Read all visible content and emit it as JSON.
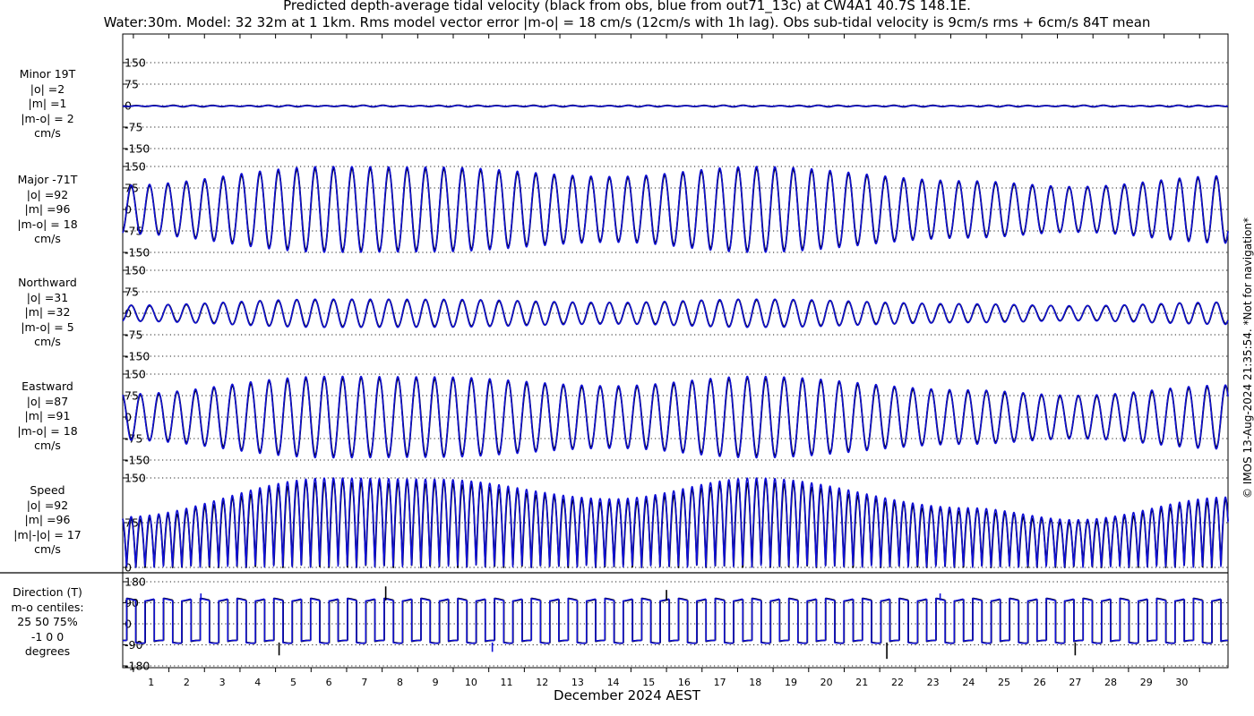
{
  "title_line1": "Predicted depth-average tidal velocity (black from obs, blue from out71_13c) at CW4A1 40.7S 148.1E.",
  "title_line2": "Water:30m. Model: 32 32m at 1 1km. Rms model vector error |m-o| = 18 cm/s (12cm/s with 1h lag). Obs sub-tidal velocity is 9cm/s rms + 6cm/s 84T mean",
  "side_note": "© IMOS 13-Aug-2024 21:35:54. *Not for navigation*",
  "xlabel": "December 2024 AEST",
  "colors": {
    "obs": "#000000",
    "model": "#1010d8",
    "grid": "#222222"
  },
  "panels": [
    {
      "id": "minor",
      "label": [
        "Minor 19T",
        "|o| =2",
        "|m| =1",
        "|m-o| = 2",
        "cm/s"
      ]
    },
    {
      "id": "major",
      "label": [
        "Major -71T",
        "|o| =92",
        "|m| =96",
        "|m-o| = 18",
        "cm/s"
      ]
    },
    {
      "id": "north",
      "label": [
        "Northward",
        "|o| =31",
        "|m| =32",
        "|m-o| = 5",
        "cm/s"
      ]
    },
    {
      "id": "east",
      "label": [
        "Eastward",
        "|o| =87",
        "|m| =91",
        "|m-o| = 18",
        "cm/s"
      ]
    },
    {
      "id": "speed",
      "label": [
        "Speed",
        "|o| =92",
        "|m| =96",
        "|m|-|o| = 17",
        "cm/s"
      ]
    },
    {
      "id": "dir",
      "label": [
        "Direction (T)",
        "m-o centiles:",
        "25  50  75%",
        "-1  0  0",
        "degrees"
      ]
    }
  ],
  "chart_data": {
    "type": "line",
    "x_unit": "day of December 2024",
    "xlim": [
      0.2,
      31.3
    ],
    "x_ticks": [
      1,
      2,
      3,
      4,
      5,
      6,
      7,
      8,
      9,
      10,
      11,
      12,
      13,
      14,
      15,
      16,
      17,
      18,
      19,
      20,
      21,
      22,
      23,
      24,
      25,
      26,
      27,
      28,
      29,
      30
    ],
    "series_names": [
      "obs",
      "model"
    ],
    "panels": [
      {
        "id": "minor",
        "ylim": [
          -150,
          150
        ],
        "y_ticks": [
          -150,
          -75,
          0,
          75,
          150
        ],
        "rms_obs": 2,
        "rms_model": 1,
        "rms_diff": 2
      },
      {
        "id": "major",
        "ylim": [
          -150,
          150
        ],
        "y_ticks": [
          -150,
          -75,
          0,
          75,
          150
        ],
        "rms_obs": 92,
        "rms_model": 96,
        "rms_diff": 18
      },
      {
        "id": "north",
        "ylim": [
          -150,
          150
        ],
        "y_ticks": [
          -150,
          -75,
          0,
          75,
          150
        ],
        "rms_obs": 31,
        "rms_model": 32,
        "rms_diff": 5
      },
      {
        "id": "east",
        "ylim": [
          -150,
          150
        ],
        "y_ticks": [
          -150,
          -75,
          0,
          75,
          150
        ],
        "rms_obs": 87,
        "rms_model": 91,
        "rms_diff": 18
      },
      {
        "id": "speed",
        "ylim": [
          0,
          150
        ],
        "y_ticks": [
          0,
          75,
          150
        ],
        "rms_obs": 92,
        "rms_model": 96,
        "rms_diff": 17
      },
      {
        "id": "dir",
        "ylim": [
          -180,
          180
        ],
        "y_ticks": [
          -180,
          -90,
          0,
          90,
          180
        ],
        "centiles": {
          "25": -1,
          "50": 0,
          "75": 0
        }
      }
    ],
    "tidal_model": {
      "semidiurnal_period_days": 0.5175,
      "major_envelope": [
        [
          0.2,
          85
        ],
        [
          6,
          150
        ],
        [
          9,
          148
        ],
        [
          14,
          115
        ],
        [
          18,
          150
        ],
        [
          24,
          100
        ],
        [
          27,
          80
        ],
        [
          31.3,
          118
        ]
      ],
      "major_direction_deg": -71
    }
  }
}
